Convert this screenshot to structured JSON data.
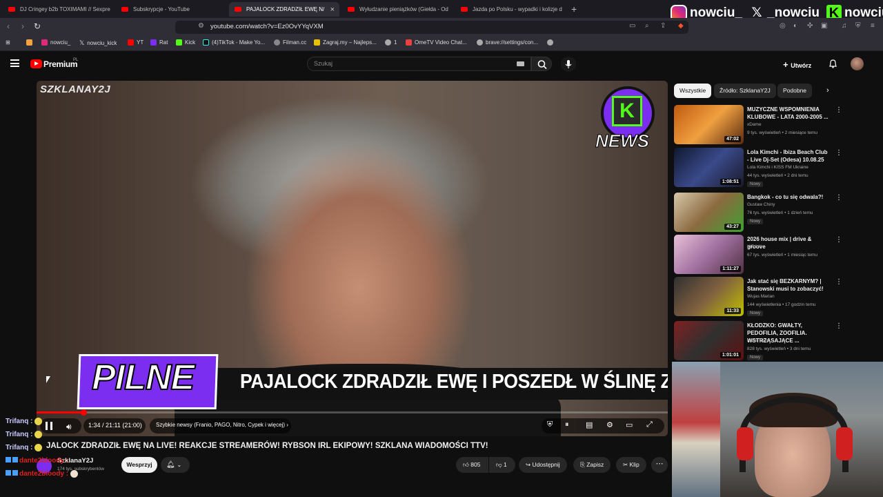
{
  "browser": {
    "tabs": [
      {
        "label": "DJ Cringey b2b TOXIMAMI // Sexpre"
      },
      {
        "label": "Subskrypcje - YouTube"
      },
      {
        "label": "PAJALOCK ZDRADZIŁ EWĘ N/"
      },
      {
        "label": "Wyłudzanie pieniążków (Giełda - Od"
      },
      {
        "label": "Jazda po Polsku - wypadki i kolizje d"
      }
    ],
    "url": "youtube.com/watch?v=Ez0OvYYqVXM",
    "bookmarks": [
      {
        "label": "nowciu_"
      },
      {
        "label": "nowciu_kick"
      },
      {
        "label": "YT"
      },
      {
        "label": "Rat"
      },
      {
        "label": "Kick"
      },
      {
        "label": "(4)TikTok - Make Yo..."
      },
      {
        "label": "Filman.cc"
      },
      {
        "label": "Zagraj.my – Najleps..."
      },
      {
        "label": "1"
      },
      {
        "label": "OmeTV Video Chat..."
      },
      {
        "label": "brave://settings/con..."
      }
    ]
  },
  "overlay": {
    "social_1": "nowciu_",
    "social_2": "_nowciu",
    "social_3": "nowciu"
  },
  "youtube": {
    "brand": "Premium",
    "brand_sup": "PL",
    "search_placeholder": "Szukaj",
    "create_label": "Utwórz"
  },
  "player": {
    "watermark": "SZKLANAY2J",
    "badge_label": "NEWS",
    "pilne": "PILNE",
    "ticker": "PAJALOCK ZDRADZIŁ EWĘ I POSZEDŁ W ŚLINĘ Z S",
    "time": "1:34 / 21:11 (21:00)",
    "chapter": "Szybkie newsy (Franio, PAGO, Nitro, Cypek i więcej)",
    "progress": 0.074
  },
  "video": {
    "title": "JALOCK ZDRADZIŁ EWĘ NA LIVE! REAKCJE STREAMERÓW! RYBSON IRL EKIPOWY! SZKLANA WIADOMOŚCI TTV!",
    "channel": "SzklanaY2J",
    "subs": "174 tys. subskrybentów",
    "support": "Wesprzyj",
    "likes": "805",
    "dislikes": "1",
    "share": "Udostępnij",
    "save": "Zapisz",
    "clip": "Klip"
  },
  "chat": [
    {
      "user": "Trifanq :"
    },
    {
      "user": "Trifanq :"
    },
    {
      "user": "Trifanq :"
    },
    {
      "user": "dante2bloody :"
    },
    {
      "user": "dante2bloody :"
    }
  ],
  "filters": [
    "Wszystkie",
    "Źródło: SzklanaY2J",
    "Podobne"
  ],
  "recommendations": [
    {
      "title": "MUZYCZNE WSPOMNIENIA KLUBOWE - LATA 2000-2005 ...",
      "channel": "xDame",
      "meta": "9 tys. wyświetleń • 2 miesiące temu",
      "duration": "47:02",
      "new": ""
    },
    {
      "title": "Lola Kimchi - Ibiza Beach Club - Live Dj-Set (Odesa) 10.08.25",
      "channel": "Lola Kimchi i KISS FM Ukraine",
      "meta": "44 tys. wyświetleń • 2 dni temu",
      "duration": "1:08:51",
      "new": "Nowy"
    },
    {
      "title": "Bangkok - co tu się odwala?!",
      "channel": "Gustaw Chiny",
      "meta": "76 tys. wyświetleń • 1 dzień temu",
      "duration": "43:27",
      "new": "Nowy"
    },
    {
      "title": "2026 house mix | drive & groove",
      "channel": "KIRA X",
      "meta": "67 tys. wyświetleń • 1 miesiąc temu",
      "duration": "1:11:27",
      "new": ""
    },
    {
      "title": "Jak stać się BEZKARNYM? | Stanowski musi to zobaczyć!",
      "channel": "Wujas Marian",
      "meta": "144 wyświetlenia • 17 godzin temu",
      "duration": "11:33",
      "new": "Nowy"
    },
    {
      "title": "KŁODZKO: GWAŁTY, PEDOFILIA, ZOOFILIA. WSTRZĄSAJĄCE ...",
      "channel": "Kanał Zero",
      "meta": "828 tys. wyświetleń • 3 dni temu",
      "duration": "1:01:01",
      "new": "Nowy"
    }
  ],
  "colors": {
    "accent": "#ff0000",
    "brand_purple": "#7b2df0",
    "kick_green": "#53fc18"
  }
}
